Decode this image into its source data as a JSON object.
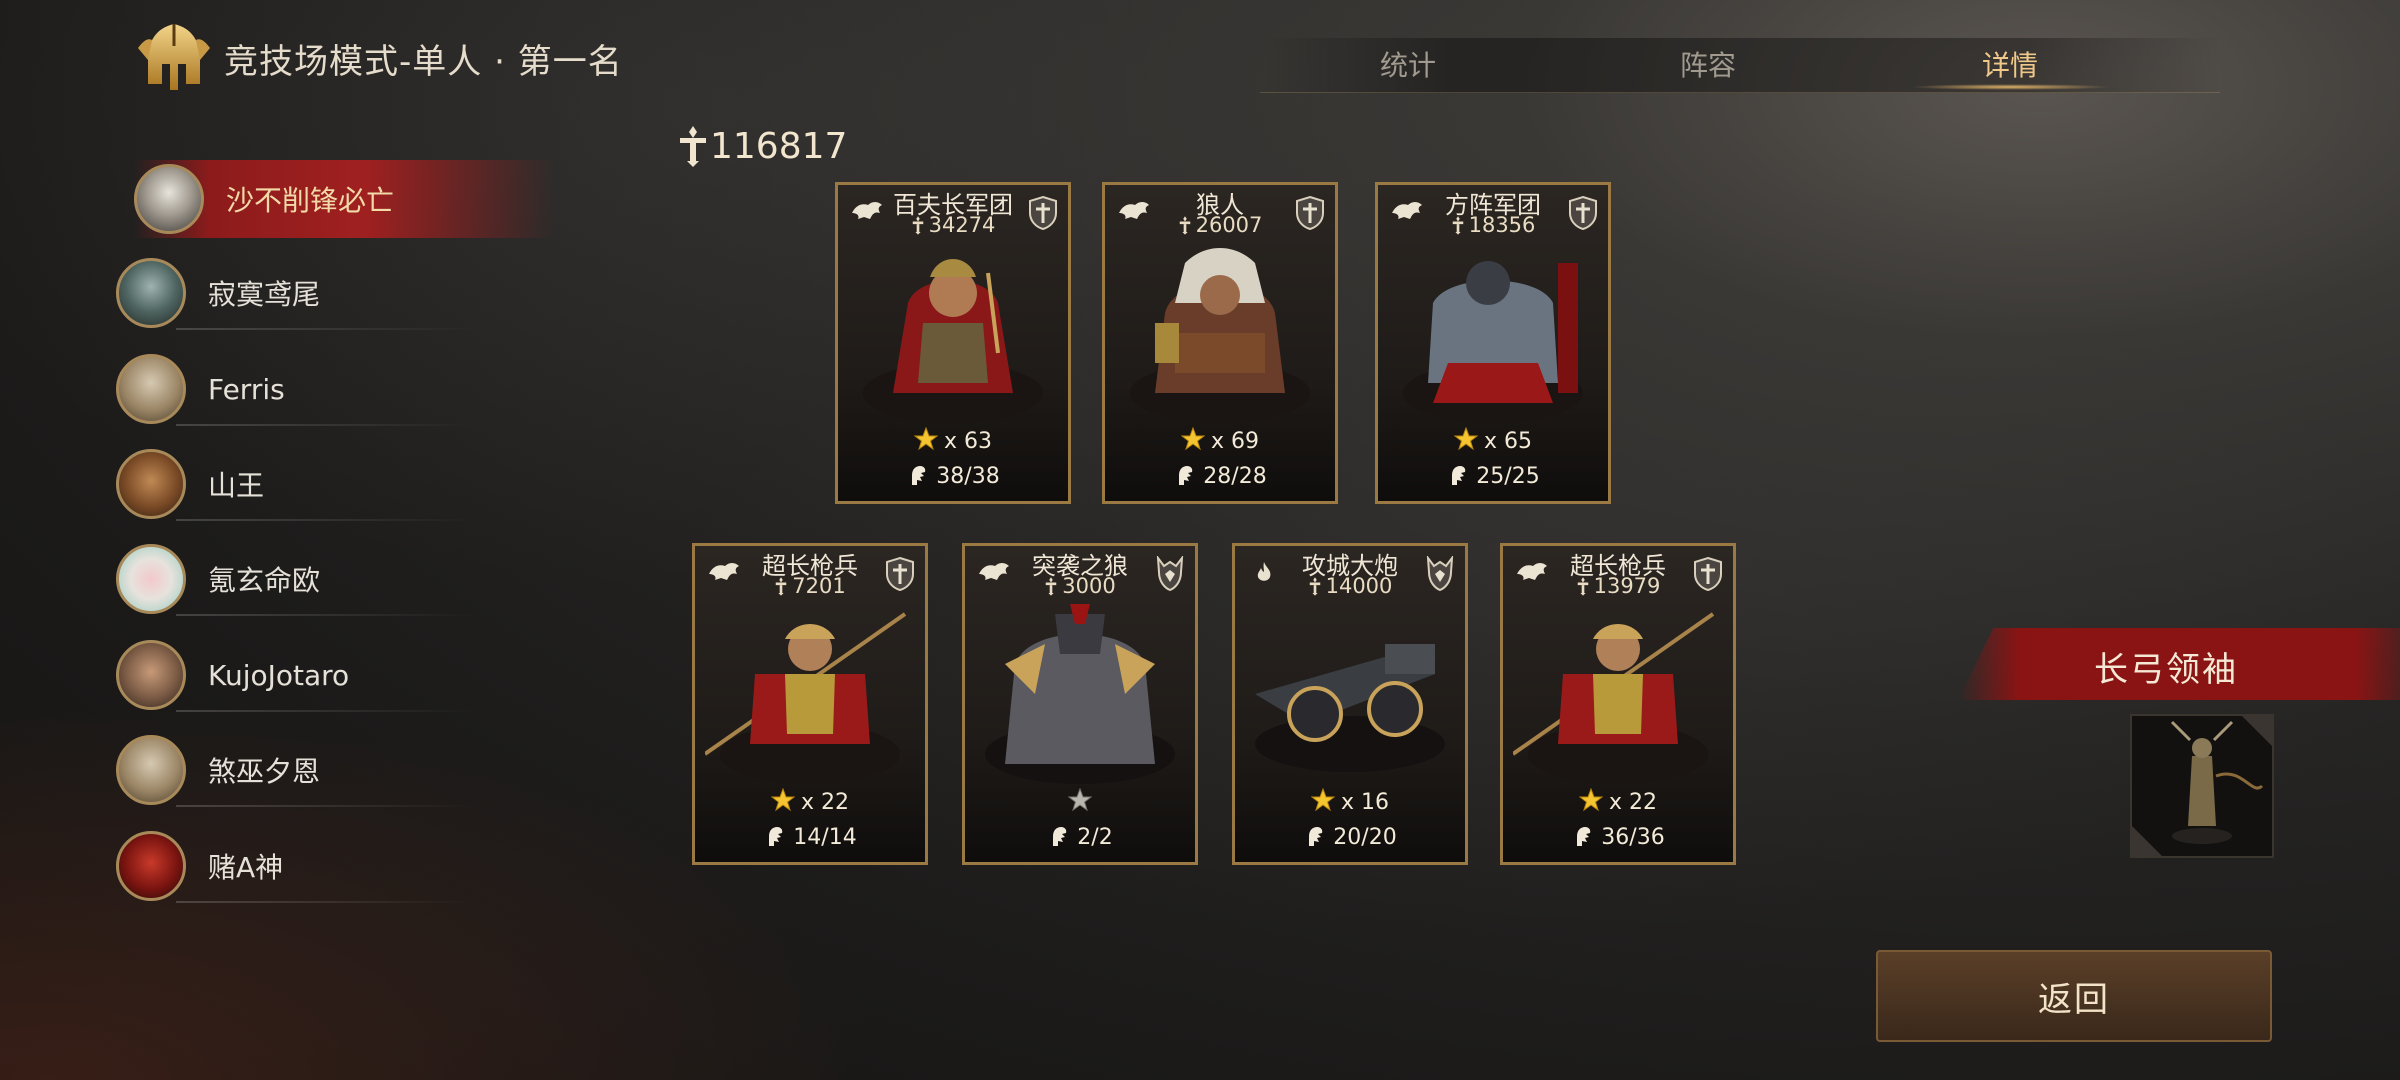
{
  "header": {
    "title": "竞技场模式-单人 · 第一名"
  },
  "tabs": [
    {
      "label": "统计",
      "active": false
    },
    {
      "label": "阵容",
      "active": false
    },
    {
      "label": "详情",
      "active": true
    }
  ],
  "players": [
    {
      "name": "沙不削锋必亡",
      "selected": true
    },
    {
      "name": "寂寞鸢尾",
      "selected": false
    },
    {
      "name": "Ferris",
      "selected": false
    },
    {
      "name": "山王",
      "selected": false
    },
    {
      "name": "氪玄命欧",
      "selected": false
    },
    {
      "name": "KujoJotaro",
      "selected": false
    },
    {
      "name": "煞巫夕恩",
      "selected": false
    },
    {
      "name": "赌A神",
      "selected": false
    }
  ],
  "total_power": "116817",
  "units": [
    {
      "name": "百夫长军团",
      "power": "34274",
      "stars": "x 63",
      "capacity": "38/38"
    },
    {
      "name": "狼人",
      "power": "26007",
      "stars": "x 69",
      "capacity": "28/28"
    },
    {
      "name": "方阵军团",
      "power": "18356",
      "stars": "x 65",
      "capacity": "25/25"
    },
    {
      "name": "超长枪兵",
      "power": "7201",
      "stars": "x 22",
      "capacity": "14/14"
    },
    {
      "name": "突袭之狼",
      "power": "3000",
      "stars": "",
      "capacity": "2/2"
    },
    {
      "name": "攻城大炮",
      "power": "14000",
      "stars": "x 16",
      "capacity": "20/20"
    },
    {
      "name": "超长枪兵",
      "power": "13979",
      "stars": "x 22",
      "capacity": "36/36"
    }
  ],
  "leader": {
    "title": "长弓领袖"
  },
  "back_button": "返回",
  "colors": {
    "accent": "#f0c98a",
    "banner": "#8a1414",
    "card_border": "#9a7a42"
  }
}
